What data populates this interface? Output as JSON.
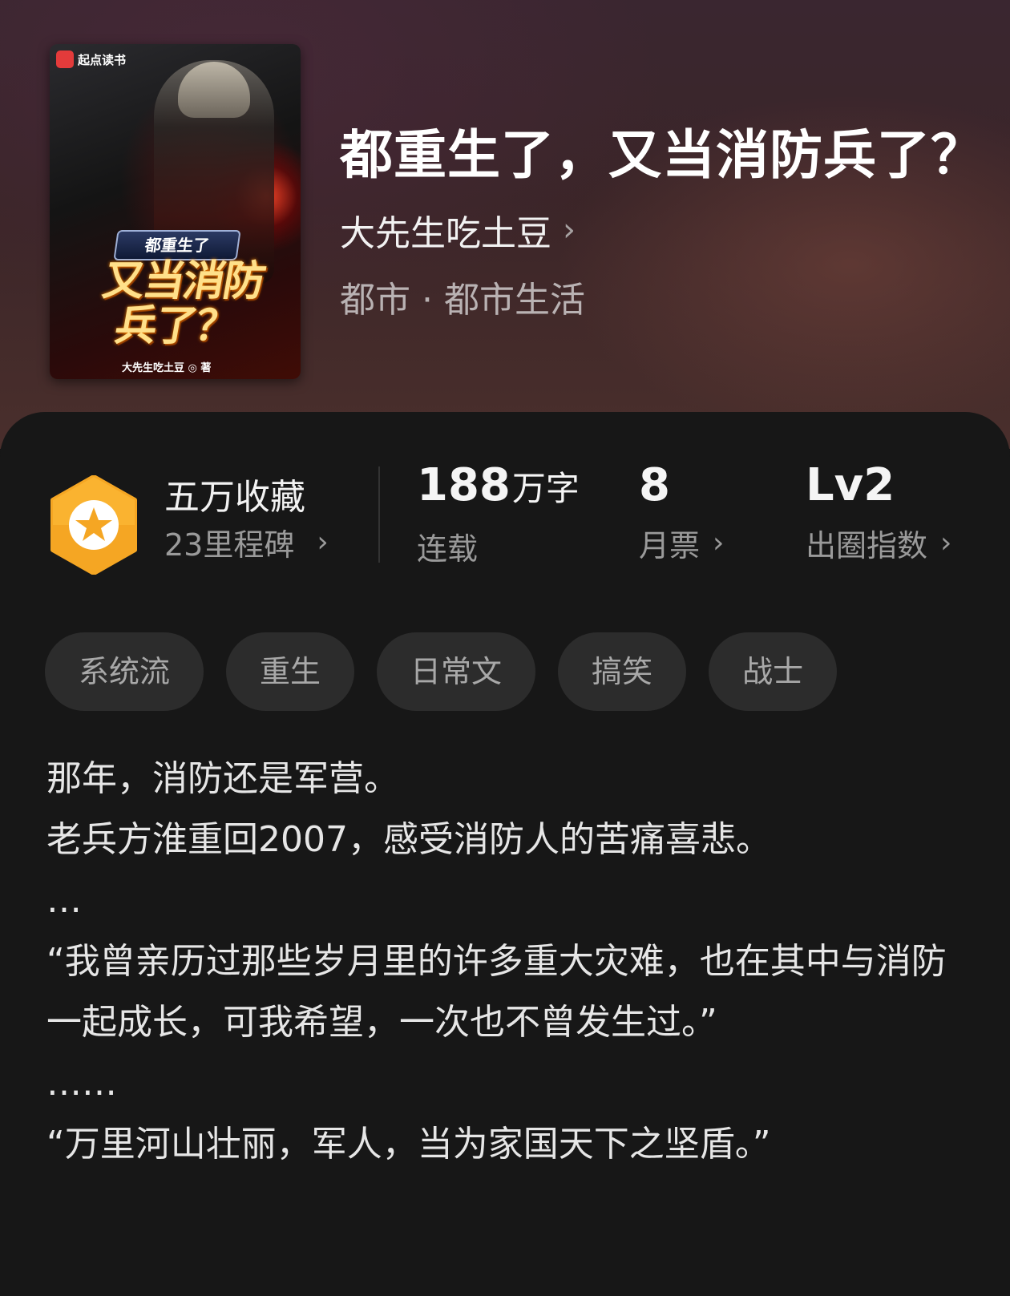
{
  "book": {
    "cover": {
      "logo_text": "起点读书",
      "subtitle": "都重生了",
      "title_line1": "又当消防",
      "title_line2": "兵了？",
      "author_credit": "大先生吃土豆 ◎ 著"
    },
    "title": "都重生了，又当消防兵了？",
    "author": "大先生吃土豆",
    "genre": "都市 · 都市生活"
  },
  "stats": {
    "collect": {
      "title": "五万收藏",
      "subtitle": "23里程碑"
    },
    "words": {
      "value": "188",
      "unit": "万字",
      "label": "连载"
    },
    "monthly_ticket": {
      "value": "8",
      "label": "月票"
    },
    "influence": {
      "value": "Lv2",
      "label": "出圈指数"
    }
  },
  "tags": [
    "系统流",
    "重生",
    "日常文",
    "搞笑",
    "战士"
  ],
  "synopsis": [
    "那年，消防还是军营。",
    "老兵方淮重回2007，感受消防人的苦痛喜悲。",
    "…",
    "“我曾亲历过那些岁月里的许多重大灾难，也在其中与消防一起成长，可我希望，一次也不曾发生过。”",
    "……",
    "“万里河山壮丽，军人，当为家国天下之坚盾。”"
  ],
  "colors": {
    "badge": "#f5a623",
    "panel": "#171717",
    "tag_bg": "#2c2c2c"
  },
  "icons": {
    "badge": "star-hexagon-icon",
    "chevron": "chevron-right-icon"
  }
}
